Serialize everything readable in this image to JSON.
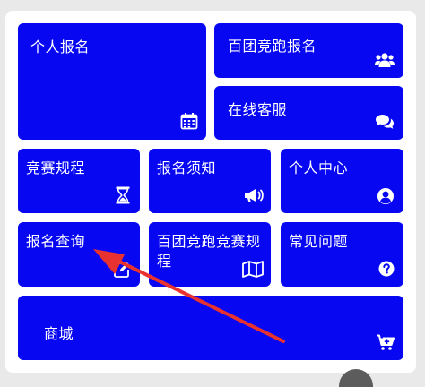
{
  "tiles": {
    "personal_signup": "个人报名",
    "baituan_signup": "百团竞跑报名",
    "online_service": "在线客服",
    "rules": "竞赛规程",
    "notice": "报名须知",
    "personal_center": "个人中心",
    "query": "报名查询",
    "baituan_rules": "百团竞跑竞赛规程",
    "faq": "常见问题",
    "mall": "商城"
  },
  "colors": {
    "tile_blue": "#0707f2",
    "annotation_arrow": "#e8322f"
  }
}
